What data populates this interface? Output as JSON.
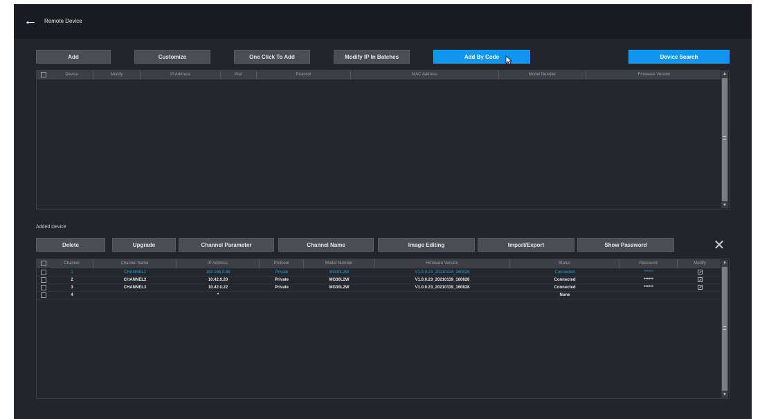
{
  "header": {
    "title": "Remote Device"
  },
  "toolbar": {
    "buttons": [
      "Add",
      "Customize",
      "One Click To Add",
      "Modify IP In Batches",
      "Add By Code"
    ],
    "device_search": "Device Search"
  },
  "search_table": {
    "columns": [
      "Device",
      "Modify",
      "IP Address",
      "Port",
      "Protocol",
      "MAC Address",
      "Model Number",
      "Firmware Version"
    ]
  },
  "added_section": {
    "label": "Added Device"
  },
  "added_toolbar": {
    "buttons": [
      "Delete",
      "Upgrade",
      "Channel Parameter",
      "Channel Name",
      "Image Editing",
      "Import/Export",
      "Show Password"
    ]
  },
  "added_table": {
    "columns": [
      "Channel",
      "Channel Name",
      "IP Address",
      "Protocol",
      "Model Number",
      "Firmware Version",
      "Status",
      "Password",
      "Modify"
    ],
    "rows": [
      {
        "channel": "1",
        "name": "CHANNEL1",
        "ip": "192.168.0.88",
        "protocol": "Private",
        "model": "MG30L2W",
        "firmware": "V1.0.0.23_20210119_160828",
        "status": "Connected",
        "password": "******"
      },
      {
        "channel": "2",
        "name": "CHANNEL2",
        "ip": "10.42.0.20",
        "protocol": "Private",
        "model": "MG30L2W",
        "firmware": "V1.0.0.23_20210119_160828",
        "status": "Connected",
        "password": "******"
      },
      {
        "channel": "3",
        "name": "CHANNEL3",
        "ip": "10.42.0.22",
        "protocol": "Private",
        "model": "MG30L2W",
        "firmware": "V1.0.0.23_20210119_160828",
        "status": "Connected",
        "password": "******"
      },
      {
        "channel": "4",
        "name": "",
        "ip": "*",
        "protocol": "",
        "model": "",
        "firmware": "",
        "status": "None",
        "password": ""
      }
    ]
  },
  "colors": {
    "accent": "#1196f0",
    "highlight_text": "#1aa6d6",
    "background": "#22252b"
  },
  "icons": {
    "back": "arrow-left-icon",
    "close": "close-icon",
    "modify": "edit-icon",
    "cursor": "mouse-pointer-icon"
  }
}
